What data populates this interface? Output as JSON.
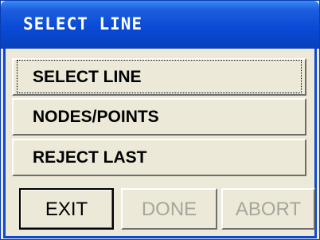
{
  "window": {
    "title": "SELECT LINE"
  },
  "list": {
    "items": [
      {
        "label": "SELECT LINE"
      },
      {
        "label": "NODES/POINTS"
      },
      {
        "label": "REJECT LAST"
      }
    ]
  },
  "buttons": {
    "exit": "EXIT",
    "done": "DONE",
    "abort": "ABORT"
  },
  "colors": {
    "titlebar": "#0a4ad6",
    "face": "#ece9d8",
    "disabled_text": "#a7a69b"
  }
}
